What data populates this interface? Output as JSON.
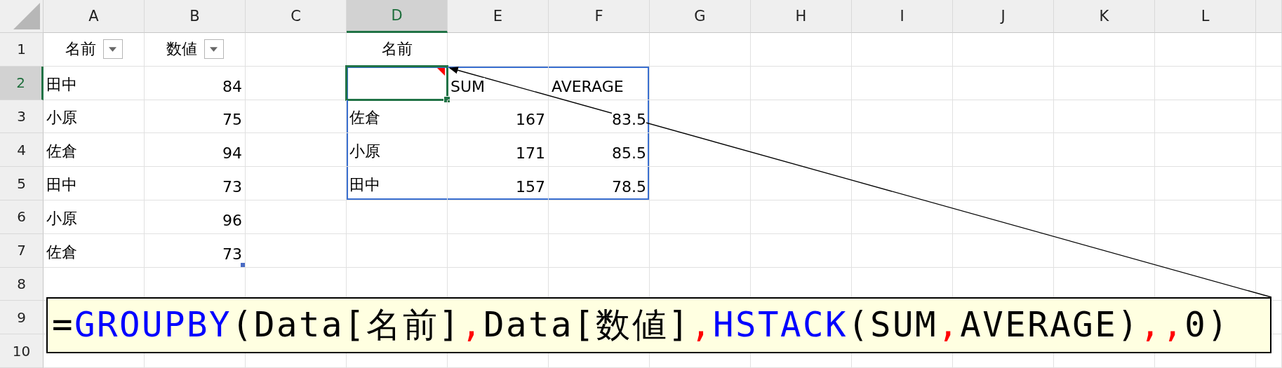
{
  "sheet": {
    "columns": [
      {
        "label": "A",
        "selected": false
      },
      {
        "label": "B",
        "selected": false
      },
      {
        "label": "C",
        "selected": false
      },
      {
        "label": "D",
        "selected": true
      },
      {
        "label": "E",
        "selected": false
      },
      {
        "label": "F",
        "selected": false
      },
      {
        "label": "G",
        "selected": false
      },
      {
        "label": "H",
        "selected": false
      },
      {
        "label": "I",
        "selected": false
      },
      {
        "label": "J",
        "selected": false
      },
      {
        "label": "K",
        "selected": false
      },
      {
        "label": "L",
        "selected": false
      }
    ],
    "rows": [
      {
        "label": "1",
        "selected": false,
        "cells": [
          {
            "text": "名前",
            "kind": "header",
            "filter": true
          },
          {
            "text": "数値",
            "kind": "header",
            "filter": true
          },
          {
            "kind": "empty"
          },
          {
            "text": "名前",
            "kind": "header"
          }
        ]
      },
      {
        "label": "2",
        "selected": true,
        "cells": [
          {
            "text": "田中",
            "kind": "text"
          },
          {
            "text": "84",
            "kind": "number"
          },
          {
            "kind": "empty"
          },
          {
            "kind": "empty",
            "active": true,
            "comment": true,
            "spill": true
          },
          {
            "text": "SUM",
            "kind": "text",
            "spill": true
          },
          {
            "text": "AVERAGE",
            "kind": "text",
            "spill": true
          }
        ]
      },
      {
        "label": "3",
        "selected": false,
        "cells": [
          {
            "text": "小原",
            "kind": "text"
          },
          {
            "text": "75",
            "kind": "number"
          },
          {
            "kind": "empty"
          },
          {
            "text": "佐倉",
            "kind": "text",
            "spill": true
          },
          {
            "text": "167",
            "kind": "number",
            "spill": true
          },
          {
            "text": "83.5",
            "kind": "number",
            "spill": true
          }
        ]
      },
      {
        "label": "4",
        "selected": false,
        "cells": [
          {
            "text": "佐倉",
            "kind": "text"
          },
          {
            "text": "94",
            "kind": "number"
          },
          {
            "kind": "empty"
          },
          {
            "text": "小原",
            "kind": "text",
            "spill": true
          },
          {
            "text": "171",
            "kind": "number",
            "spill": true
          },
          {
            "text": "85.5",
            "kind": "number",
            "spill": true
          }
        ]
      },
      {
        "label": "5",
        "selected": false,
        "cells": [
          {
            "text": "田中",
            "kind": "text"
          },
          {
            "text": "73",
            "kind": "number"
          },
          {
            "kind": "empty"
          },
          {
            "text": "田中",
            "kind": "text",
            "spill": true
          },
          {
            "text": "157",
            "kind": "number",
            "spill": true
          },
          {
            "text": "78.5",
            "kind": "number",
            "spill": true
          }
        ]
      },
      {
        "label": "6",
        "selected": false,
        "cells": [
          {
            "text": "小原",
            "kind": "text"
          },
          {
            "text": "96",
            "kind": "number"
          }
        ]
      },
      {
        "label": "7",
        "selected": false,
        "cells": [
          {
            "text": "佐倉",
            "kind": "text"
          },
          {
            "text": "73",
            "kind": "number",
            "table_end": true
          }
        ]
      },
      {
        "label": "8",
        "selected": false,
        "cells": []
      },
      {
        "label": "9",
        "selected": false,
        "cells": []
      },
      {
        "label": "10",
        "selected": false,
        "cells": []
      }
    ]
  },
  "formula_callout": {
    "tokens": [
      {
        "text": "=",
        "kind": "plain"
      },
      {
        "text": "GROUPBY",
        "kind": "function"
      },
      {
        "text": "(Data[名前]",
        "kind": "plain"
      },
      {
        "text": ",",
        "kind": "separator"
      },
      {
        "text": "Data[数値]",
        "kind": "plain"
      },
      {
        "text": ",",
        "kind": "separator"
      },
      {
        "text": "HSTACK",
        "kind": "function"
      },
      {
        "text": "(SUM",
        "kind": "plain"
      },
      {
        "text": ",",
        "kind": "separator"
      },
      {
        "text": "AVERAGE)",
        "kind": "plain"
      },
      {
        "text": ",,",
        "kind": "separator"
      },
      {
        "text": "0)",
        "kind": "plain"
      }
    ]
  }
}
